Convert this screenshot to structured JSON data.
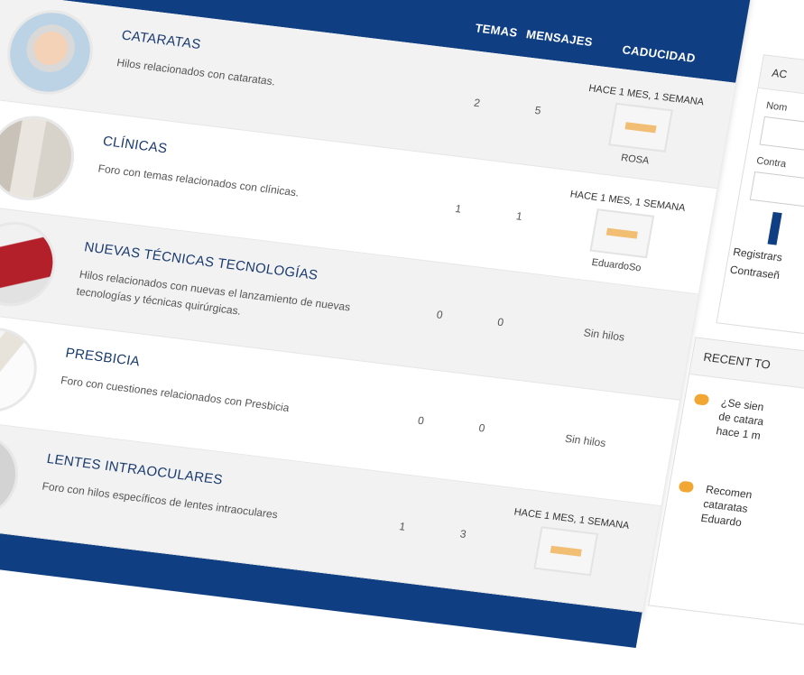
{
  "header": {
    "col_temas": "TEMAS",
    "col_mensajes": "MENSAJES",
    "col_caducidad": "CADUCIDAD"
  },
  "forums": [
    {
      "title": "CATARATAS",
      "description": "Hilos relacionados con cataratas.",
      "topics": "2",
      "posts": "5",
      "last_time": "HACE 1 MES, 1 SEMANA",
      "last_user": "ROSA"
    },
    {
      "title": "CLÍNICAS",
      "description": "Foro con temas relacionados con clínicas.",
      "topics": "1",
      "posts": "1",
      "last_time": "HACE 1 MES, 1 SEMANA",
      "last_user": "EduardoSo"
    },
    {
      "title": "NUEVAS TÉCNICAS TECNOLOGÍAS",
      "description": "Hilos relacionados con nuevas el lanzamiento de nuevas tecnologías y técnicas quirúrgicas.",
      "topics": "0",
      "posts": "0",
      "last_text": "Sin hilos"
    },
    {
      "title": "PRESBICIA",
      "description": "Foro con cuestiones relacionados con Presbicia",
      "topics": "0",
      "posts": "0",
      "last_text": "Sin hilos"
    },
    {
      "title": "LENTES INTRAOCULARES",
      "description": "Foro con hilos específicos de lentes intraoculares",
      "topics": "1",
      "posts": "3",
      "last_time": "HACE 1 MES, 1 SEMANA"
    }
  ],
  "sidebar": {
    "login_title": "AC",
    "label_user": "Nom",
    "label_pass": "Contra",
    "link_register": "Registrars",
    "link_password": "Contraseñ",
    "recent_title": "RECENT TO",
    "recent_items": [
      {
        "line1": "¿Se sien",
        "line2": "de catara",
        "line3": "hace 1 m"
      },
      {
        "line1": "Recomen",
        "line2": "cataratas",
        "line3": "Eduardo"
      }
    ]
  },
  "colors": {
    "header_blue": "#0f3f82",
    "title_blue": "#1b3b6f",
    "bubble_orange": "#f2a735"
  }
}
